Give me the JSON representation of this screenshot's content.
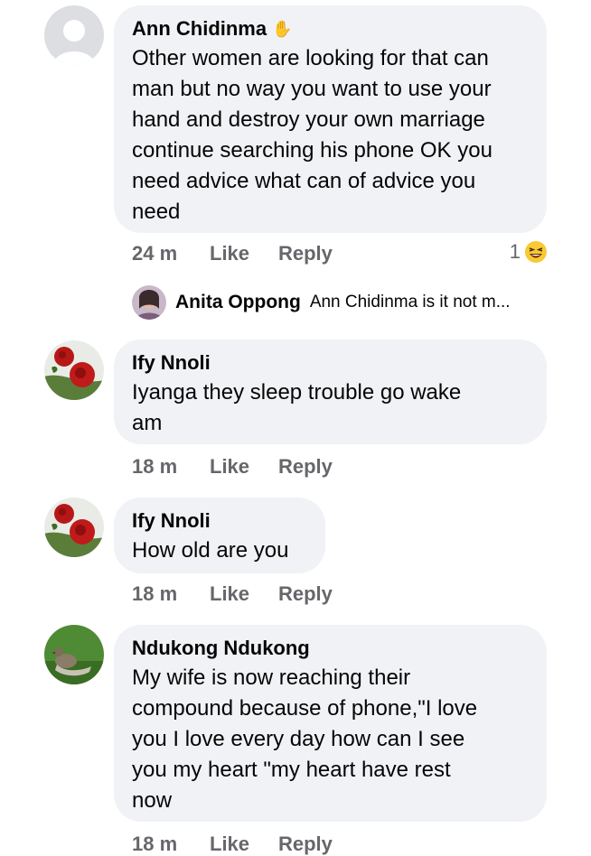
{
  "comments": [
    {
      "author": "Ann Chidinma",
      "author_badge_icon": "waving-hand-icon",
      "text_lines": [
        "Other women are looking for that can",
        "man but no way you want to use your",
        "hand and destroy your own marriage",
        "continue searching his phone OK you",
        "need advice what can of advice you",
        "need"
      ],
      "time": "24 m",
      "like": "Like",
      "reply": "Reply",
      "reaction_count": "1",
      "reaction_icon": "laughing-emoji-icon"
    },
    {
      "author": "Ify Nnoli",
      "text_lines": [
        "Iyanga they sleep trouble go wake",
        "am"
      ],
      "time": "18 m",
      "like": "Like",
      "reply": "Reply"
    },
    {
      "author": "Ify Nnoli",
      "text_lines": [
        "How old are you"
      ],
      "time": "18 m",
      "like": "Like",
      "reply": "Reply"
    },
    {
      "author": "Ndukong Ndukong",
      "text_lines": [
        "My wife is now reaching their",
        "compound because of phone,\"I love",
        "you I love every day how can I see",
        "you my heart \"my heart have rest",
        "now"
      ],
      "time": "18 m",
      "like": "Like",
      "reply": "Reply"
    }
  ],
  "reply_preview": {
    "author": "Anita Oppong",
    "text": "Ann Chidinma is it not m..."
  },
  "colors": {
    "bubble": "#f0f2f5",
    "meta_text": "#65676b",
    "primary_text": "#050505"
  }
}
